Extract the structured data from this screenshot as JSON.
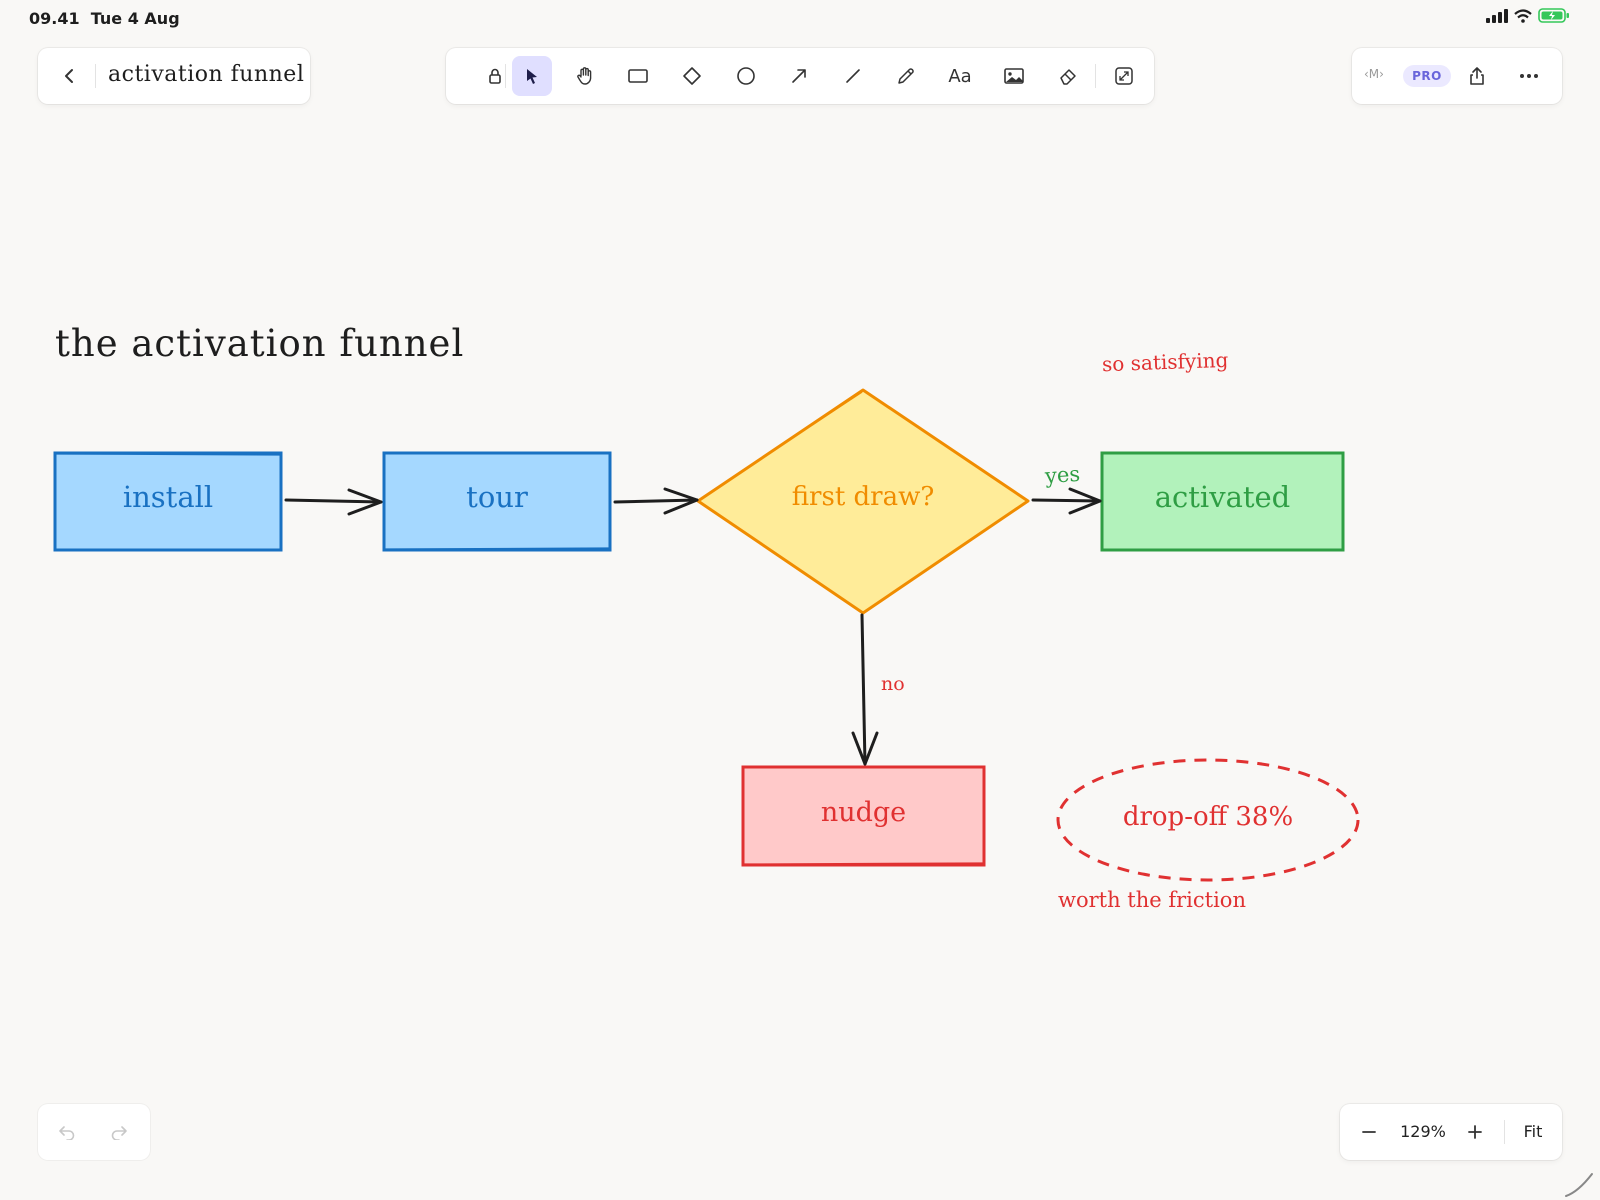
{
  "status_bar": {
    "time": "09.41",
    "date": "Tue 4 Aug"
  },
  "header": {
    "document_title": "activation funnel",
    "back_icon": "chevron-left-icon"
  },
  "toolbar": {
    "tools": [
      {
        "name": "lock",
        "icon": "lock-icon"
      },
      {
        "name": "selection",
        "icon": "pointer-icon",
        "active": true
      },
      {
        "name": "hand",
        "icon": "hand-icon"
      },
      {
        "name": "rectangle",
        "icon": "rectangle-icon"
      },
      {
        "name": "diamond",
        "icon": "diamond-icon"
      },
      {
        "name": "ellipse",
        "icon": "circle-icon"
      },
      {
        "name": "arrow",
        "icon": "arrow-icon"
      },
      {
        "name": "line",
        "icon": "line-icon"
      },
      {
        "name": "draw",
        "icon": "pencil-icon"
      },
      {
        "name": "text",
        "icon": "text-icon",
        "label": "Aa"
      },
      {
        "name": "image",
        "icon": "image-icon"
      },
      {
        "name": "eraser",
        "icon": "eraser-icon"
      },
      {
        "name": "extra-tools",
        "icon": "resize-icon"
      }
    ]
  },
  "top_right": {
    "markdown_badge": "‹M›",
    "pro_badge": "PRO",
    "share_icon": "share-icon",
    "more_icon": "more-icon"
  },
  "canvas": {
    "title": "the activation funnel",
    "nodes": {
      "install": "install",
      "tour": "tour",
      "decision": "first draw?",
      "activated": "activated",
      "nudge": "nudge",
      "dropoff": "drop-off 38%"
    },
    "edge_labels": {
      "yes": "yes",
      "no": "no"
    },
    "notes": {
      "satisfying": "so satisfying",
      "friction": "worth the friction"
    },
    "colors": {
      "blue_fill": "#a5d8ff",
      "blue_stroke": "#1971c2",
      "yellow_fill": "#ffec99",
      "yellow_stroke": "#f08c00",
      "green_fill": "#b2f2bb",
      "green_stroke": "#2f9e44",
      "red_fill": "#ffc9c9",
      "red_stroke": "#e03131",
      "ink": "#1e1e1e"
    }
  },
  "zoom": {
    "level": "129%",
    "fit_label": "Fit"
  },
  "history": {
    "undo_icon": "undo-icon",
    "redo_icon": "redo-icon"
  }
}
